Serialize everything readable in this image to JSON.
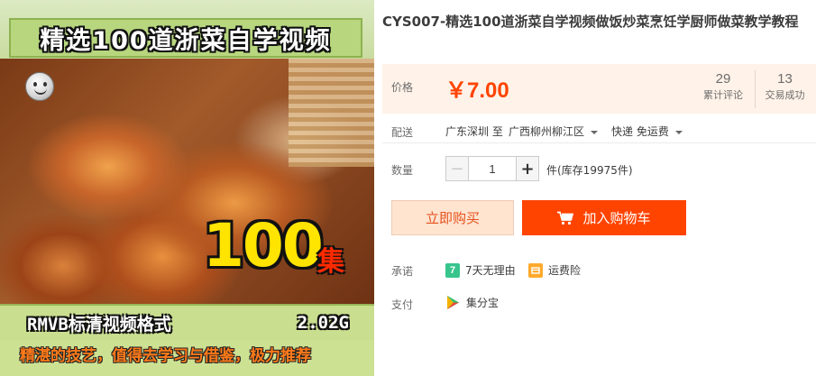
{
  "image": {
    "title_banner": "精选100道浙菜自学视频",
    "big_number": "100",
    "big_suffix": "集",
    "format_text": "RMVB标清视频格式",
    "size_text": "2.02G",
    "slogan": "精湛的技艺，值得去学习与借鉴，极力推荐"
  },
  "product": {
    "title": "CYS007-精选100道浙菜自学视频做饭炒菜烹饪学厨师做菜教学教程"
  },
  "price": {
    "label": "价格",
    "value": "￥7.00",
    "reviews_count": "29",
    "reviews_label": "累计评论",
    "deals_count": "13",
    "deals_label": "交易成功"
  },
  "shipping": {
    "label": "配送",
    "from": "广东深圳 至",
    "to": "广西柳州柳江区",
    "method": "快递 免运费"
  },
  "quantity": {
    "label": "数量",
    "value": "1",
    "minus": "−",
    "plus": "+",
    "stock_text": "件(库存19975件)"
  },
  "actions": {
    "buy_now": "立即购买",
    "add_to_cart": "加入购物车"
  },
  "promise": {
    "label": "承诺",
    "return_icon_text": "7",
    "return_text": "7天无理由",
    "insurance_text": "运费险"
  },
  "payment": {
    "label": "支付",
    "method": "集分宝"
  },
  "icons": {
    "cart": "cart-icon",
    "return": "seven-day-return-icon",
    "insurance": "shipping-insurance-icon",
    "payment": "jifenbao-icon",
    "mascot": "smiley-icon"
  },
  "colors": {
    "accent": "#ff4400",
    "price_bg": "#fff2e8",
    "buy_bg": "#ffe4d0"
  }
}
